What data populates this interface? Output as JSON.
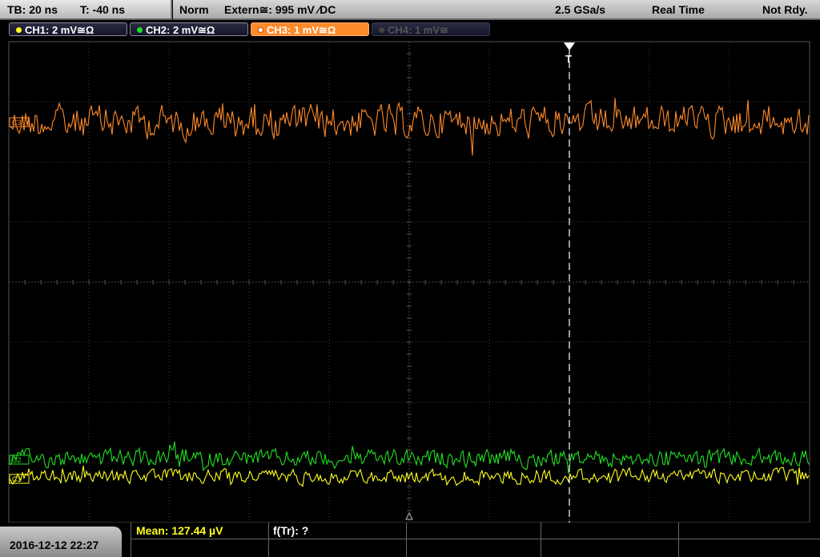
{
  "status_bar": {
    "timebase": "TB: 20 ns",
    "trigger_time": "T: -40 ns",
    "mode": "Norm",
    "trigger_source": "Extern≅: 995 mV ∕DC",
    "sample_rate": "2.5 GSa/s",
    "acquisition": "Real Time",
    "state": "Not Rdy."
  },
  "channels": [
    {
      "label": "CH1: 2 mV≅Ω",
      "color": "#ffff20",
      "active": false,
      "enabled": true
    },
    {
      "label": "CH2: 2 mV≅Ω",
      "color": "#20e020",
      "active": false,
      "enabled": true
    },
    {
      "label": "CH3: 1 mV≅Ω",
      "color": "#ff8a2a",
      "active": true,
      "enabled": true
    },
    {
      "label": "CH4: 1 mV≅",
      "color": "#555555",
      "active": false,
      "enabled": false
    }
  ],
  "markers": {
    "trigger_label": "T",
    "ch3_marker": "C3",
    "ch2_marker": "C2",
    "ch1_marker": "C1"
  },
  "measurements": {
    "mean": "Mean: 127.44 µV",
    "freq": "f(Tr): ?"
  },
  "datetime": "2016-12-12 22:27",
  "trace_colors": {
    "ch1": "#ffff20",
    "ch2": "#20e020",
    "ch3": "#ff8a2a"
  }
}
